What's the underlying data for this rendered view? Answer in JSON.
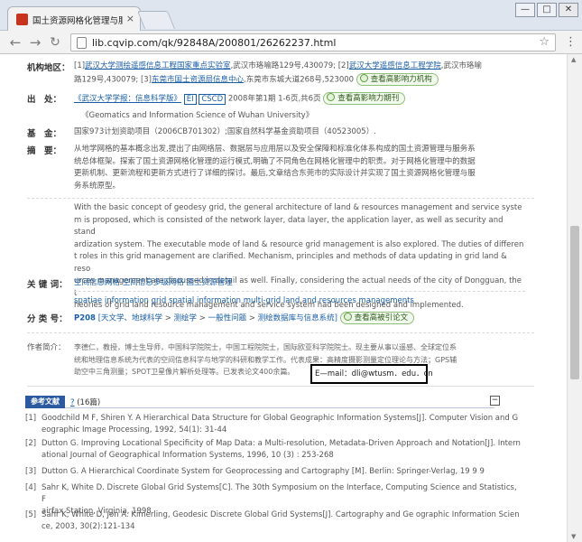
{
  "browser": {
    "tab_title": "国土资源网格化管理与服",
    "tab_close": "×",
    "url": "lib.cqvip.com/qk/92848A/200801/26262237.html",
    "window_buttons": [
      "—",
      "□",
      "✕"
    ]
  },
  "record": {
    "affiliation": {
      "label": "机构地区：",
      "line1_prefix": "[1]",
      "line1_link1": "武汉大学测绘遥感信息工程国家重点实验室",
      "line1_mid": ",武汉市珞喻路129号,430079; [2]",
      "line1_link2": "武汉大学遥感信息工程学院",
      "line1_suffix": ",武汉市珞喻",
      "line2_prefix": "路129号,430079; [3]",
      "line2_link": "东莞市国土资源局信息中心",
      "line2_suffix": ",东莞市东城大道268号,523000",
      "button": "查看高影响力机构"
    },
    "source": {
      "label": "出　处：",
      "journal_link": "《武汉大学学报：信息科学版》",
      "badge1": "EI",
      "badge2": "CSCD",
      "issue": "2008年第1期 1-6页,共6页",
      "button": "查看高影响力期刊",
      "english_title": "《Geomatics and Information Science of Wuhan University》"
    },
    "fund": {
      "label": "基　金：",
      "text": "国家973计划资助项目（2006CB701302）;国家自然科学基金资助项目（40523005）."
    },
    "abstract": {
      "label": "摘　要：",
      "zh_lines": [
        "从地学网格的基本概念出发,提出了由网络层、数据层与应用层以及安全保障和标准化体系构成的国土资源管理与服务系",
        "统总体框架。探索了国土资源网格化管理的运行模式,明确了不同角色在网格化管理中的职责。对于网格化管理中的数据",
        "更新机制、更新流程和更新方式进行了详细的探讨。最后,文章结合东莞市的实际设计并实现了国土资源网格化管理与服",
        "务系统原型。"
      ],
      "en_lines": [
        "With the basic concept of geodesy grid, the general architecture of land & resources management and service syste",
        "m is proposed, which is consisted of the network layer, data layer, the application layer, as well as security and stand",
        "ardization system. The executable mode of land & resource grid management is also explored. The duties of differen",
        "t roles in this grid management are clarified. Mechanism, principles and methods of data updating in grid land & reso",
        "urces management are discussed in detail as well. Finally, considering the actual needs of the city of Dongguan, the t",
        "heories of grid land resource management and service system had been designed and implemented."
      ]
    },
    "keywords": {
      "label": "关 键 词：",
      "zh": [
        "空间信息网格",
        "空间信息多级网格",
        "国土资源管理"
      ],
      "en": "spatiae information grid spatial information multi-grid land and resources managements"
    },
    "classification": {
      "label": "分 类 号：",
      "code": "P208",
      "path": [
        "[天文学、地球科学",
        "测绘学",
        "一般性问题",
        "测绘数据库与信息系统]"
      ],
      "sep": ">",
      "button": "查看高被引论文"
    },
    "author_intro": {
      "label": "作者简介：",
      "lines": [
        "李德仁，教授，博士生导师，中国科学院院士，中国工程院院士，国际欧亚科学院院士。现主要从事以遥感、全球定位系",
        "统和地理信息系统为代表的空间信息科学与地学的科研和教学工作。代表成果：高精度摄影测量定位理论与方法；GPS辅",
        "助空中三角测量；SPOT卫星像片解析处理等。已发表论文400余篇。"
      ],
      "email": "E—mail：dli@wtusm．edu．cn"
    },
    "references": {
      "tab_label": "参考文献",
      "count": "(16篇)",
      "collapse": "−",
      "items": [
        {
          "num": "[1]",
          "lines": [
            "Goodchild M F, Shiren Y. A Hierarchical Data Structure for Global Geographic Information Systems[J]. Computer Vision and G",
            "eographic Image Processing, 1992, 54(1): 31-44"
          ]
        },
        {
          "num": "[2]",
          "lines": [
            "Dutton G. Improving Locational Specificity of Map Data: a Multi-resolution, Metadata-Driven Approach and Notation[J]. Intern",
            "ational Journal of Geographical Information Systems, 1996, 10 (3) : 253-268"
          ]
        },
        {
          "num": "[3]",
          "lines": [
            "Dutton G. A Hierarchical Coordinate System for Geoprocessing and Cartography [M]. Berlin: Springer-Verlag, 19 9 9"
          ]
        },
        {
          "num": "[4]",
          "lines": [
            "Sahr K, White D. Discrete Global Grid Systems[C]. The 30th Symposium on the Interface, Computing Science and Statistics, F",
            "airfax Station, Virginia, 1998"
          ]
        },
        {
          "num": "[5]",
          "lines": [
            "Sahr K, White D, Jon A. Kimerling, Geodesic Discrete Global Grid Systems[J]. Cartography and Ge ographic Information Scien",
            "ce, 2003, 30(2):121-134"
          ]
        }
      ]
    }
  }
}
